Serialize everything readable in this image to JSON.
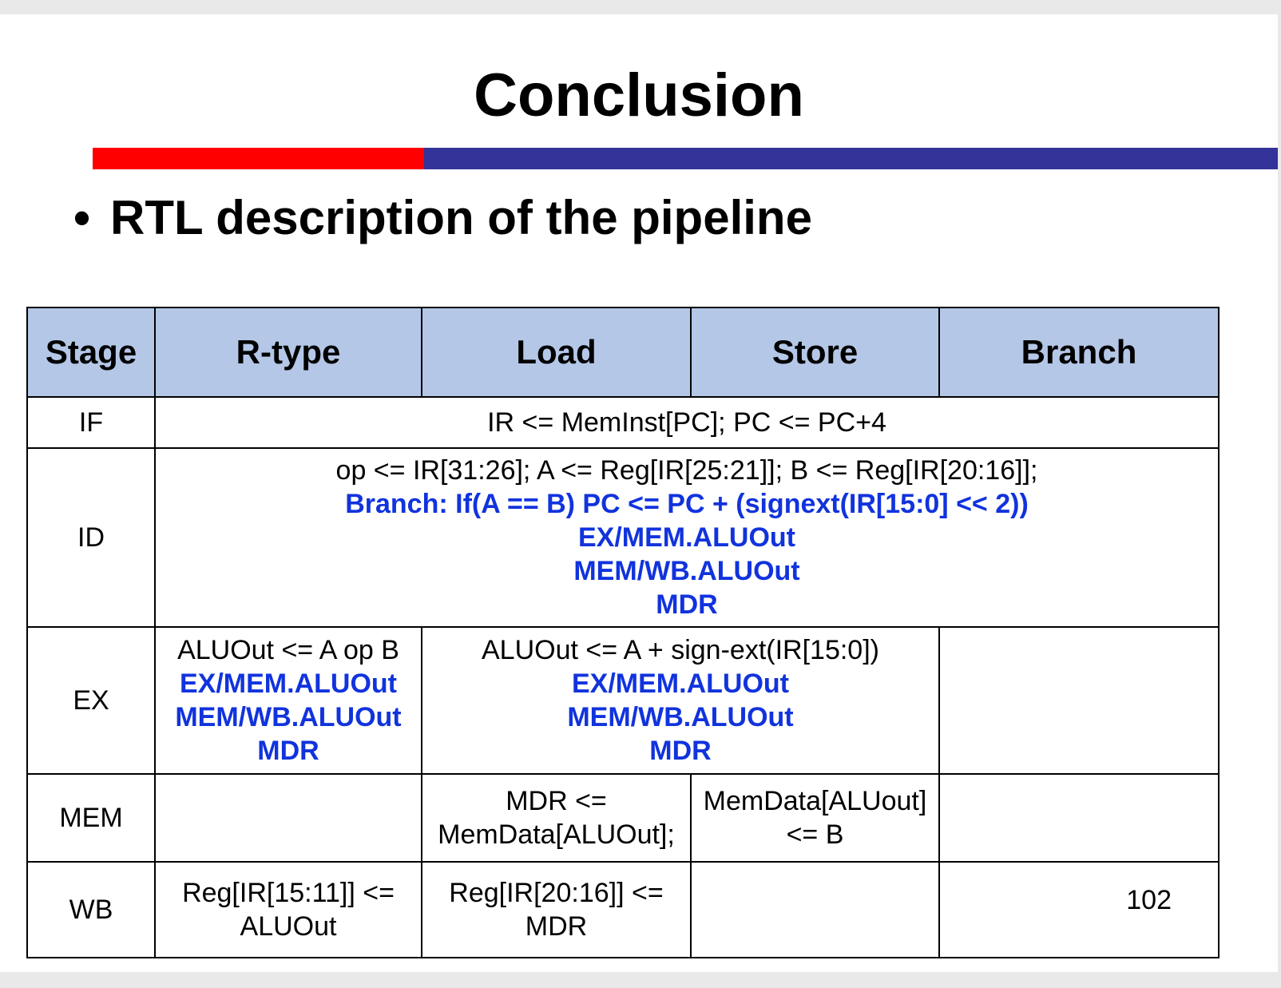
{
  "title": "Conclusion",
  "bullet": "RTL description of the pipeline",
  "header": {
    "stage": "Stage",
    "rtype": "R-type",
    "load": "Load",
    "store": "Store",
    "branch": "Branch"
  },
  "rows": {
    "if": {
      "stage": "IF",
      "text": "IR <= MemInst[PC];  PC <= PC+4"
    },
    "id": {
      "stage": "ID",
      "line1": "op <= IR[31:26]; A <= Reg[IR[25:21]];  B <= Reg[IR[20:16]];",
      "line2": "Branch: If(A == B) PC <= PC + (signext(IR[15:0] << 2))",
      "line3": "EX/MEM.ALUOut",
      "line4": "MEM/WB.ALUOut",
      "line5": "MDR"
    },
    "ex": {
      "stage": "EX",
      "rtype": {
        "line1": "ALUOut <= A op B",
        "line2": "EX/MEM.ALUOut",
        "line3": "MEM/WB.ALUOut",
        "line4": "MDR"
      },
      "loadstore": {
        "line1": "ALUOut <= A + sign-ext(IR[15:0])",
        "line2": "EX/MEM.ALUOut",
        "line3": "MEM/WB.ALUOut",
        "line4": "MDR"
      }
    },
    "mem": {
      "stage": "MEM",
      "load": {
        "line1": "MDR <=",
        "line2": "MemData[ALUOut];"
      },
      "store": {
        "line1": "MemData[ALUout]",
        "line2": "<= B"
      }
    },
    "wb": {
      "stage": "WB",
      "rtype": {
        "line1": "Reg[IR[15:11]] <=",
        "line2": "ALUOut"
      },
      "load": {
        "line1": "Reg[IR[20:16]] <=",
        "line2": "MDR"
      }
    }
  },
  "page_number": "102",
  "colors": {
    "bar_red": "#ff0000",
    "bar_blue": "#333399",
    "header_bg": "#b4c7e7",
    "highlight_text": "#1133dd"
  }
}
